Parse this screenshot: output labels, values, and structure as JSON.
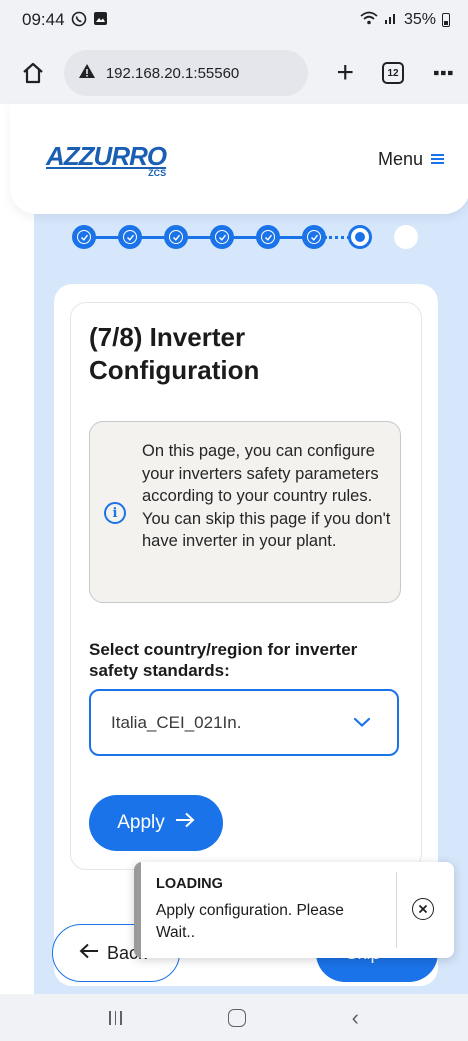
{
  "status_bar": {
    "time": "09:44",
    "battery": "35%"
  },
  "browser": {
    "url": "192.168.20.1:55560",
    "tab_count": "12"
  },
  "header": {
    "logo_text": "AZZURRO",
    "logo_sub": "ZCS",
    "menu_label": "Menu"
  },
  "stepper": {
    "total_steps": 8,
    "current_step": 7
  },
  "card": {
    "title": "(7/8) Inverter Configuration",
    "info_text": "On this page, you can configure your inverters safety parameters according to your country rules. You can skip this page if you don't have inverter in your plant.",
    "select_label": "Select country/region for inverter safety standards:",
    "select_value": "Italia_CEI_021In.",
    "apply_label": "Apply"
  },
  "nav_buttons": {
    "back_label": "Back",
    "skip_label": "Skip"
  },
  "toast": {
    "title": "LOADING",
    "message": "Apply configuration. Please Wait.."
  },
  "colors": {
    "accent": "#1a73e8",
    "page_bg": "#d6e6fb",
    "toast_bar": "#9a9a9a"
  },
  "icons": [
    "whatsapp-icon",
    "gallery-icon",
    "wifi-icon",
    "signal-icon",
    "battery-icon",
    "home-icon",
    "warning-icon",
    "plus-icon",
    "tabs-icon",
    "more-icon",
    "menu-icon",
    "check-icon",
    "info-icon",
    "chevron-down-icon",
    "arrow-right-icon",
    "arrow-left-icon",
    "close-circle-icon"
  ]
}
